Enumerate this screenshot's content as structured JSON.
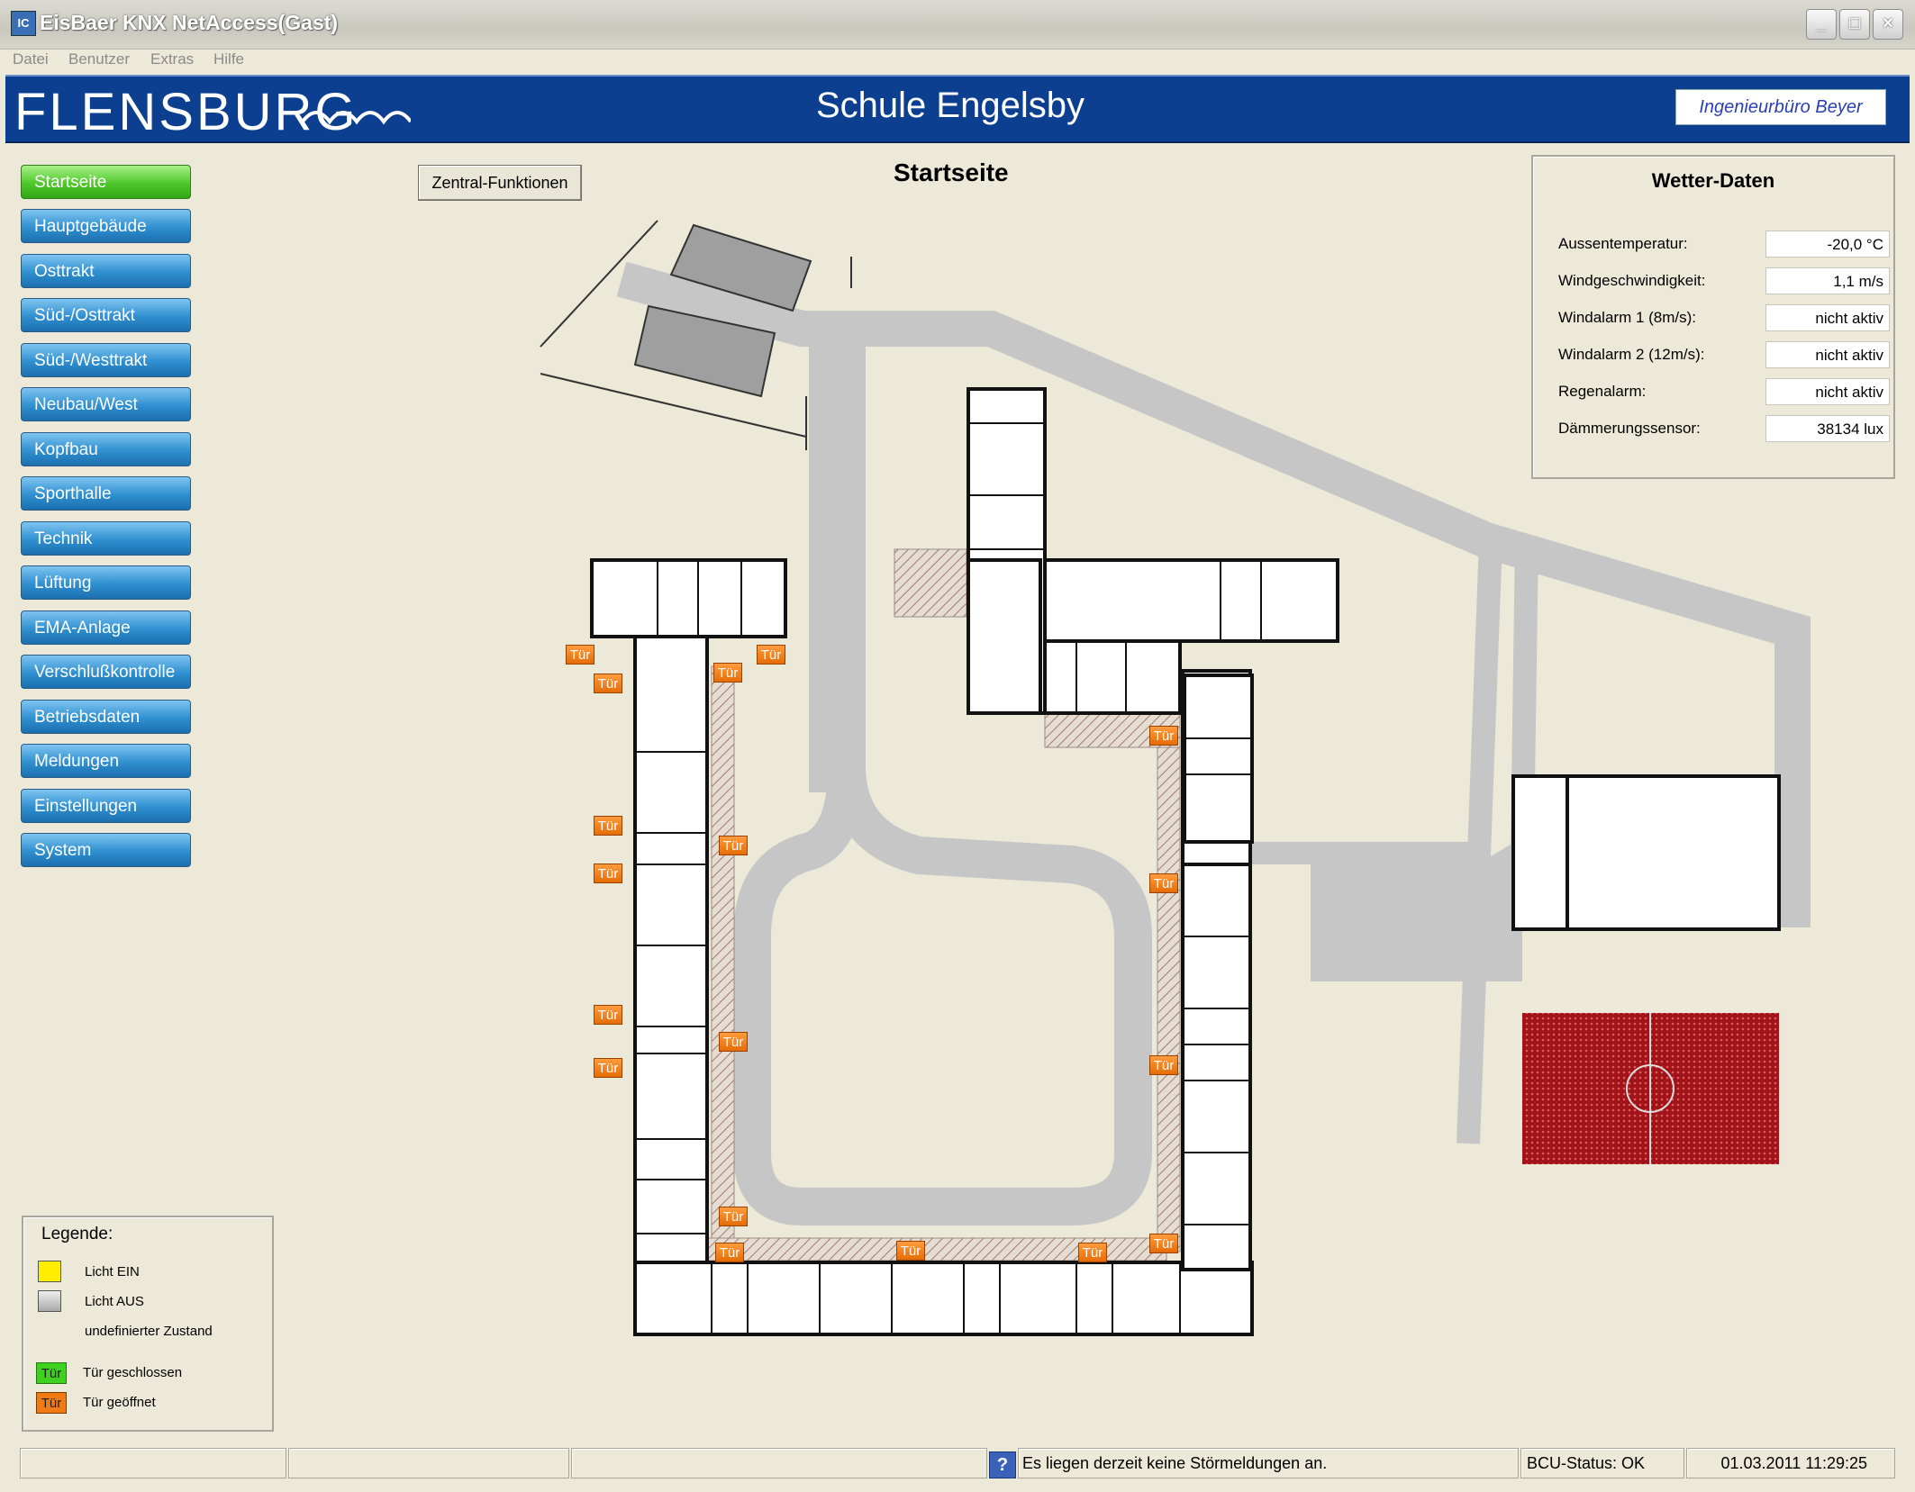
{
  "window": {
    "title": "EisBaer KNX NetAccess(Gast)",
    "icon": "eisbaer-app-icon"
  },
  "menu": [
    "Datei",
    "Benutzer",
    "Extras",
    "Hilfe"
  ],
  "banner": {
    "logo_text": "FLENSBURG",
    "school": "Schule Engelsby",
    "brand": "Ingenieurbüro Beyer"
  },
  "nav": [
    {
      "label": "Startseite",
      "active": true
    },
    {
      "label": "Hauptgebäude"
    },
    {
      "label": "Osttrakt"
    },
    {
      "label": "Süd-/Osttrakt"
    },
    {
      "label": "Süd-/Westtrakt"
    },
    {
      "label": "Neubau/West"
    },
    {
      "label": "Kopfbau"
    },
    {
      "label": "Sporthalle"
    },
    {
      "label": "Technik"
    },
    {
      "label": "Lüftung"
    },
    {
      "label": "EMA-Anlage"
    },
    {
      "label": "Verschlußkontrolle"
    },
    {
      "label": "Betriebsdaten"
    },
    {
      "label": "Meldungen"
    },
    {
      "label": "Einstellungen"
    },
    {
      "label": "System"
    }
  ],
  "toolbar": {
    "zentral_label": "Zentral-Funktionen"
  },
  "page": {
    "title": "Startseite"
  },
  "weather": {
    "title": "Wetter-Daten",
    "rows": [
      {
        "label": "Aussentemperatur:",
        "value": "-20,0 °C"
      },
      {
        "label": "Windgeschwindigkeit:",
        "value": "1,1 m/s"
      },
      {
        "label": "Windalarm 1 (8m/s):",
        "value": "nicht aktiv"
      },
      {
        "label": "Windalarm 2 (12m/s):",
        "value": "nicht aktiv"
      },
      {
        "label": "Regenalarm:",
        "value": "nicht aktiv"
      },
      {
        "label": "Dämmerungssensor:",
        "value": "38134 lux"
      }
    ]
  },
  "doors": {
    "label": "Tür",
    "state": "geöffnet",
    "open_color": "#f07a14",
    "closed_color": "#3fd11f"
  },
  "legend": {
    "title": "Legende:",
    "light_on": "Licht EIN",
    "light_off": "Licht AUS",
    "undefined": "undefinierter Zustand",
    "door_closed": "Tür geschlossen",
    "door_open": "Tür geöffnet",
    "door_label": "Tür",
    "colors": {
      "light_on": "#ffee00",
      "light_off": "#c8c8c8"
    }
  },
  "statusbar": {
    "message": "Es liegen derzeit keine Störmeldungen an.",
    "bcu": "BCU-Status:  OK",
    "datetime": "01.03.2011 11:29:25"
  }
}
